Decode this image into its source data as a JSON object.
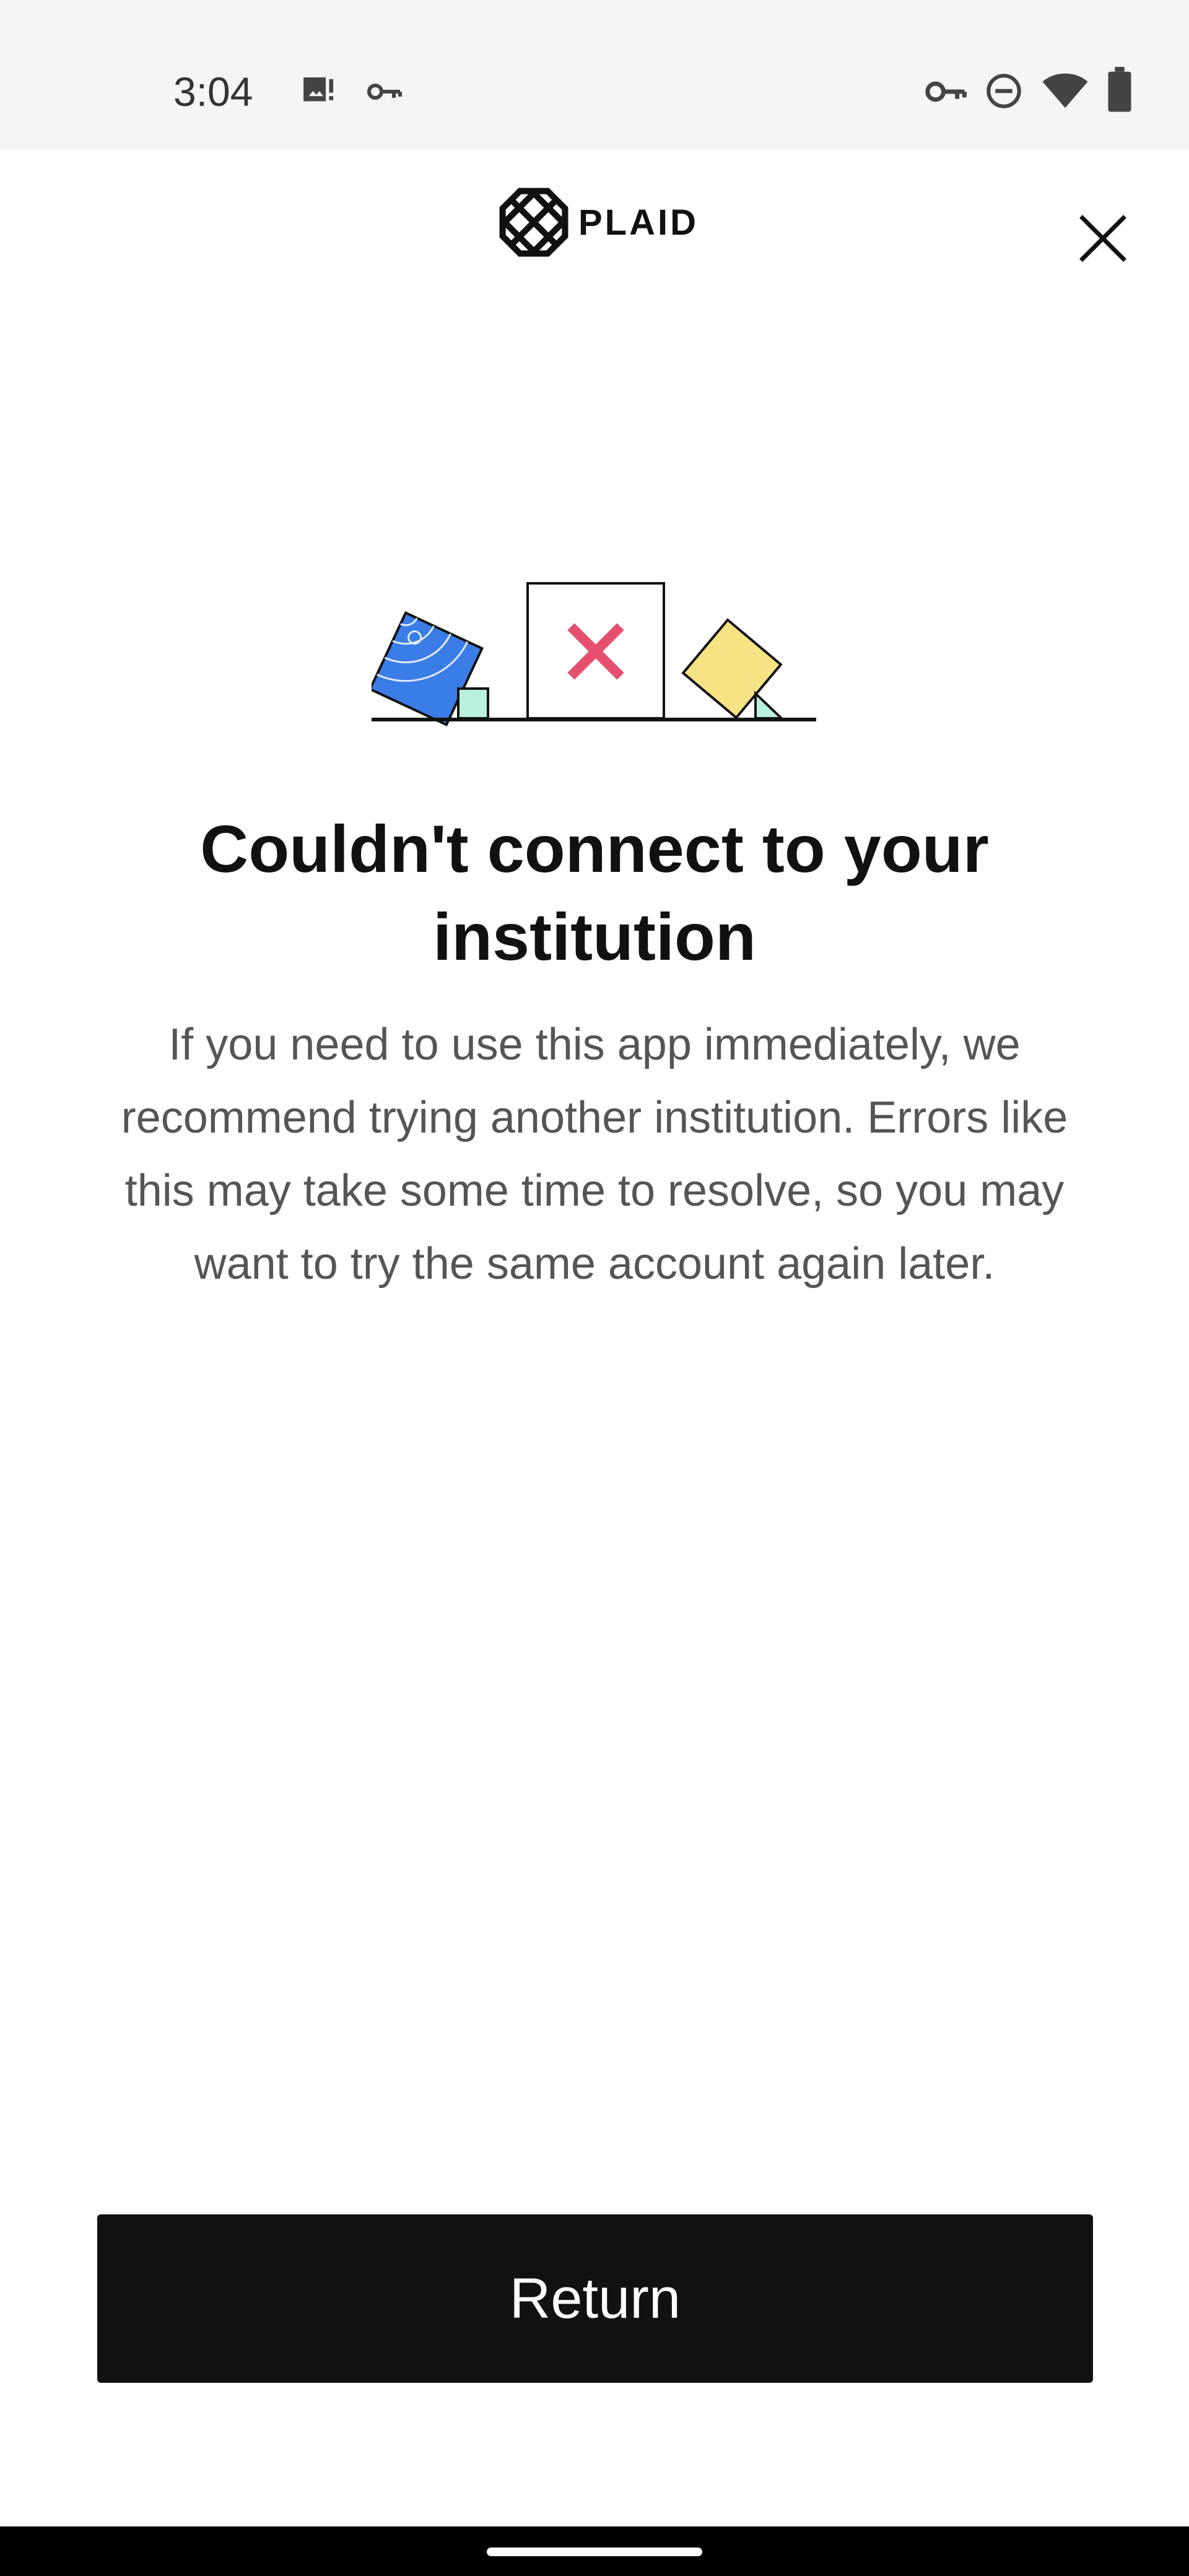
{
  "status_bar": {
    "time": "3:04",
    "left_icons": [
      "image-alert-icon",
      "key-icon"
    ],
    "right_icons": [
      "vpn-key-icon",
      "do-not-disturb-icon",
      "wifi-icon",
      "battery-icon"
    ]
  },
  "header": {
    "logo_text": "PLAID",
    "close_icon": "close-icon"
  },
  "illustration": {
    "colors": {
      "blue": "#3b7de6",
      "mint": "#b8f2dc",
      "red_x": "#e6506e",
      "yellow": "#f5e384"
    }
  },
  "content": {
    "title": "Couldn't connect to your institution",
    "body": "If you need to use this app immediately, we recommend trying another institution. Errors like this may take some time to resolve, so you may want to try the same account again later."
  },
  "actions": {
    "return_label": "Return"
  },
  "colors": {
    "button_bg": "#111111",
    "title": "#111111",
    "body": "#555555",
    "status_bar_bg": "#f5f5f5"
  }
}
